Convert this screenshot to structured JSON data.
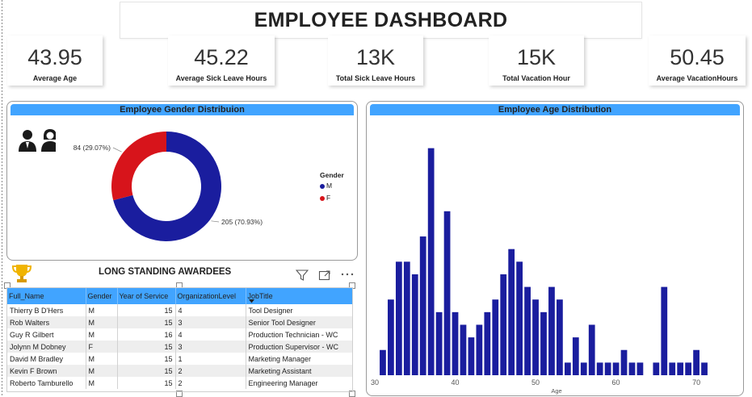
{
  "title": "EMPLOYEE DASHBOARD",
  "kpis": [
    {
      "value": "43.95",
      "label": "Average Age"
    },
    {
      "value": "45.22",
      "label": "Average Sick Leave Hours"
    },
    {
      "value": "13K",
      "label": "Total Sick Leave Hours"
    },
    {
      "value": "15K",
      "label": "Total Vacation Hour"
    },
    {
      "value": "50.45",
      "label": "Average VacationHours"
    }
  ],
  "gender_panel": {
    "title": "Employee Gender Distribuion",
    "legend_title": "Gender",
    "icons": [
      "male-user-icon",
      "female-user-icon"
    ]
  },
  "age_panel": {
    "title": "Employee Age Distribution"
  },
  "awardees": {
    "title": "LONG STANDING AWARDEES",
    "trophy_icon": "trophy-icon",
    "tools": [
      "filter-icon",
      "focus-mode-icon",
      "more-options-icon"
    ],
    "columns": [
      "Full_Name",
      "Gender",
      "Year of Service",
      "OrganizationLevel",
      "JobTitle"
    ],
    "rows": [
      [
        "Thierry B D'Hers",
        "M",
        "15",
        "4",
        "Tool Designer"
      ],
      [
        "Rob Walters",
        "M",
        "15",
        "3",
        "Senior Tool Designer"
      ],
      [
        "Guy R Gilbert",
        "M",
        "16",
        "4",
        "Production Technician - WC"
      ],
      [
        "Jolynn M Dobney",
        "F",
        "15",
        "3",
        "Production Supervisor - WC"
      ],
      [
        "David M Bradley",
        "M",
        "15",
        "1",
        "Marketing Manager"
      ],
      [
        "Kevin F Brown",
        "M",
        "15",
        "2",
        "Marketing Assistant"
      ],
      [
        "Roberto Tamburello",
        "M",
        "15",
        "2",
        "Engineering Manager"
      ]
    ]
  },
  "chart_data": [
    {
      "type": "pie",
      "title": "Employee Gender Distribuion",
      "donut": true,
      "legend_title": "Gender",
      "legend_position": "right",
      "categories": [
        "M",
        "F"
      ],
      "values": [
        205,
        84
      ],
      "data_labels": [
        "205 (70.93%)",
        "84 (29.07%)"
      ],
      "colors": [
        "#1a1d9e",
        "#d7141b"
      ]
    },
    {
      "type": "bar",
      "title": "Employee Age Distribution",
      "xlabel": "Age",
      "ylabel": "",
      "x": [
        31,
        32,
        33,
        34,
        35,
        36,
        37,
        38,
        39,
        40,
        41,
        42,
        43,
        44,
        45,
        46,
        47,
        48,
        49,
        50,
        51,
        52,
        53,
        54,
        55,
        56,
        57,
        58,
        59,
        60,
        61,
        62,
        63,
        65,
        66,
        67,
        68,
        69,
        70,
        71
      ],
      "values": [
        2,
        6,
        9,
        9,
        8,
        11,
        18,
        5,
        13,
        5,
        4,
        3,
        4,
        5,
        6,
        8,
        10,
        9,
        7,
        6,
        5,
        7,
        6,
        1,
        3,
        1,
        4,
        1,
        1,
        1,
        2,
        1,
        1,
        1,
        7,
        1,
        1,
        1,
        2,
        1
      ],
      "ylim": [
        0,
        19
      ],
      "xticks": [
        "30",
        "40",
        "50",
        "60",
        "70"
      ],
      "xlim": [
        29.8,
        72
      ],
      "color": "#1a1d9e",
      "grid": false
    }
  ]
}
